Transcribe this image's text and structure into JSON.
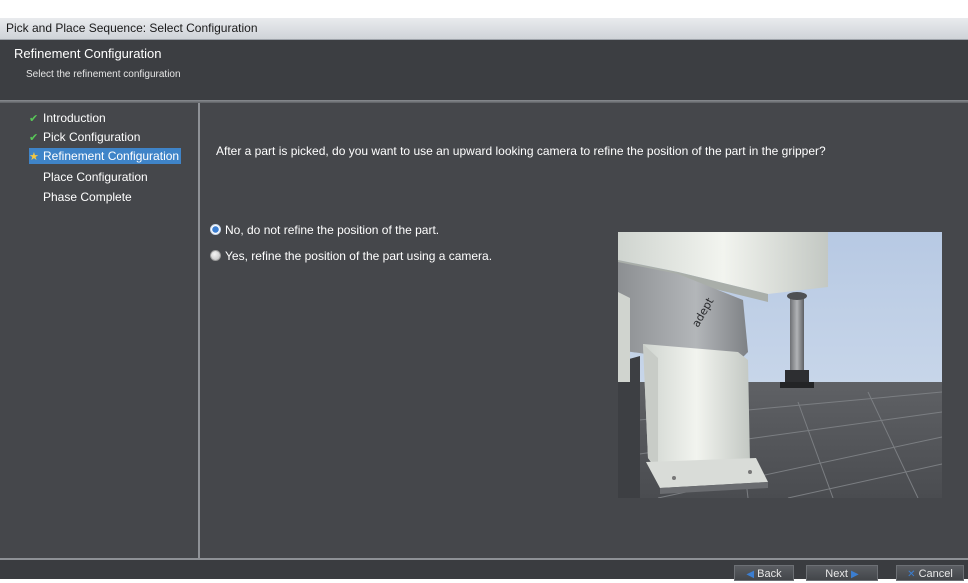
{
  "window": {
    "title": "Pick and Place Sequence: Select Configuration"
  },
  "header": {
    "title": "Refinement Configuration",
    "subtitle": "Select the refinement configuration"
  },
  "sidebar": {
    "items": [
      {
        "label": "Introduction",
        "state": "done"
      },
      {
        "label": "Pick Configuration",
        "state": "done"
      },
      {
        "label": "Refinement Configuration",
        "state": "current"
      },
      {
        "label": "Place Configuration",
        "state": "pending"
      },
      {
        "label": "Phase Complete",
        "state": "pending"
      }
    ]
  },
  "main": {
    "question": "After a part is picked, do you want to use an upward looking camera to refine the position of the part in the gripper?",
    "options": [
      {
        "label": "No, do not refine the position of the part.",
        "selected": true
      },
      {
        "label": "Yes, refine the position of the part using a camera.",
        "selected": false
      }
    ],
    "preview_logo": "adept"
  },
  "footer": {
    "back_label": "Back",
    "next_label": "Next",
    "cancel_label": "Cancel"
  },
  "colors": {
    "accent": "#3f84c8",
    "check": "#58c858",
    "current": "#f4c842",
    "background": "#45474b"
  },
  "icons": {
    "done": "check-icon",
    "current": "star-icon",
    "back": "arrow-left-icon",
    "next": "arrow-right-icon",
    "cancel": "close-icon"
  }
}
